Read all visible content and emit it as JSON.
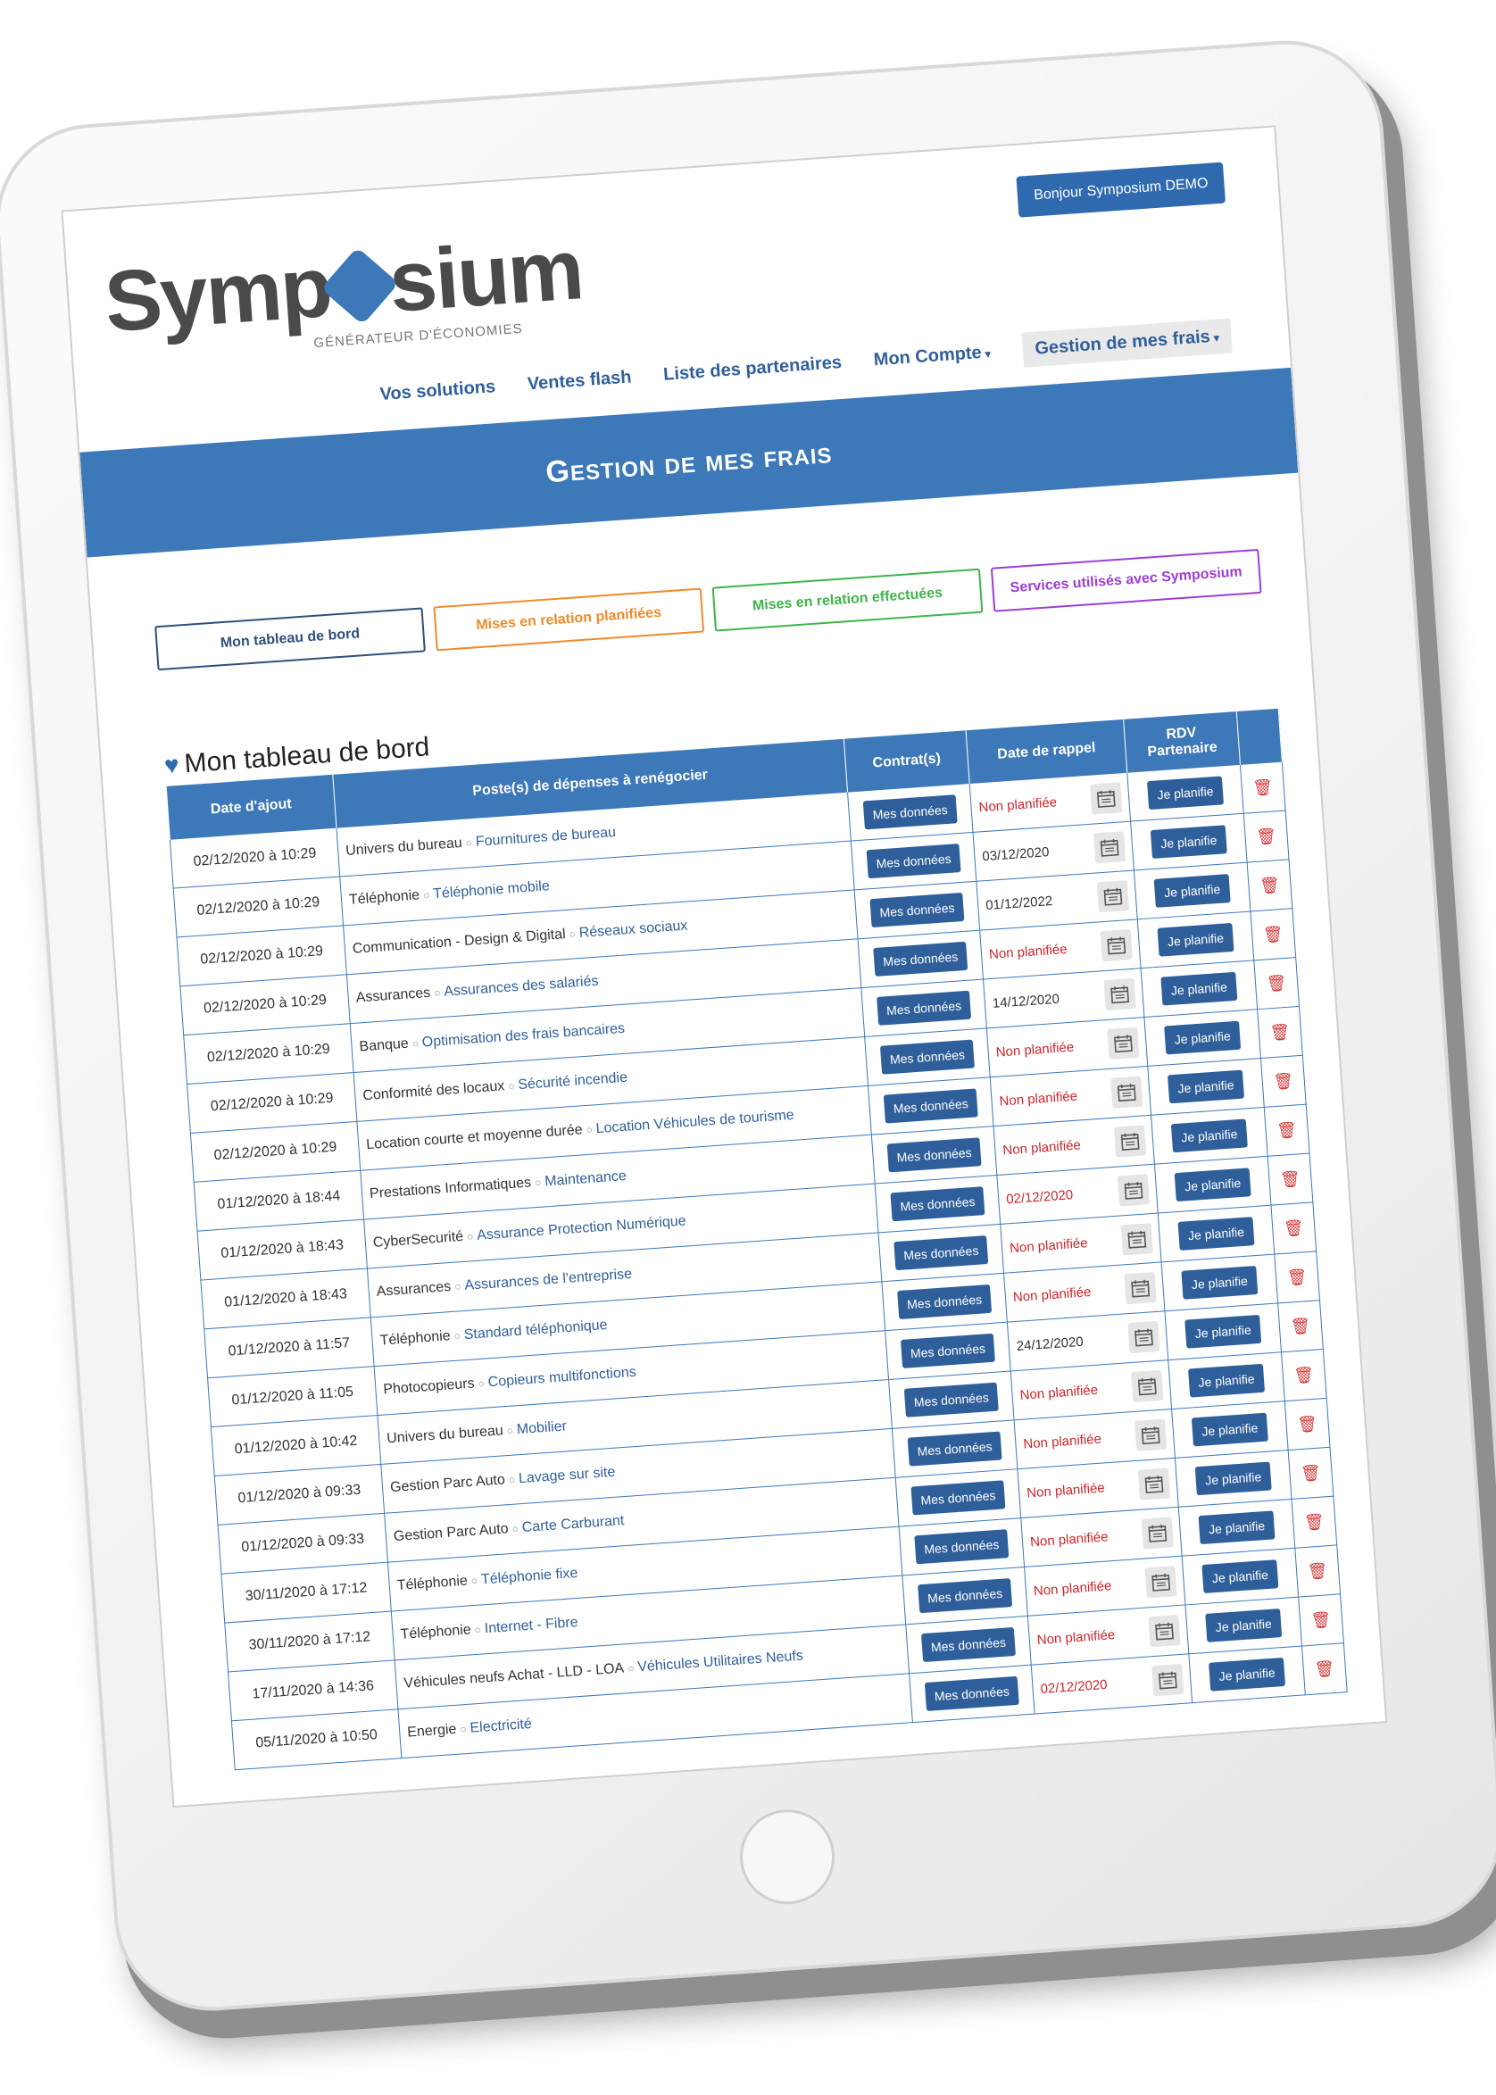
{
  "brand": {
    "name_part1": "Symp",
    "name_part2": "sium",
    "tagline": "GÉNÉRATEUR D'ÉCONOMIES"
  },
  "header": {
    "greeting": "Bonjour Symposium DEMO",
    "nav": [
      {
        "label": "Vos solutions"
      },
      {
        "label": "Ventes flash"
      },
      {
        "label": "Liste des partenaires"
      },
      {
        "label": "Mon Compte"
      },
      {
        "label": "Gestion de mes frais"
      }
    ]
  },
  "banner": {
    "title": "Gestion de mes frais"
  },
  "tabs": [
    {
      "label": "Mon tableau de bord"
    },
    {
      "label": "Mises en relation planifiées"
    },
    {
      "label": "Mises en relation effectuées"
    },
    {
      "label": "Services utilisés avec Symposium"
    }
  ],
  "section": {
    "title": "Mon tableau de bord"
  },
  "table": {
    "headers": {
      "date": "Date d'ajout",
      "poste": "Poste(s) de dépenses à renégocier",
      "contrat": "Contrat(s)",
      "rappel": "Date de rappel",
      "rdv": "RDV Partenaire"
    },
    "contract_button": "Mes données",
    "rdv_button": "Je planifie",
    "rows": [
      {
        "date": "02/12/2020 à 10:29",
        "cat": "Univers du bureau",
        "sub": "Fournitures de bureau",
        "rappel": "Non planifiée",
        "rappel_red": true
      },
      {
        "date": "02/12/2020 à 10:29",
        "cat": "Téléphonie",
        "sub": "Téléphonie mobile",
        "rappel": "03/12/2020",
        "rappel_red": false
      },
      {
        "date": "02/12/2020 à 10:29",
        "cat": "Communication - Design & Digital",
        "sub": "Réseaux sociaux",
        "rappel": "01/12/2022",
        "rappel_red": false
      },
      {
        "date": "02/12/2020 à 10:29",
        "cat": "Assurances",
        "sub": "Assurances des salariés",
        "rappel": "Non planifiée",
        "rappel_red": true
      },
      {
        "date": "02/12/2020 à 10:29",
        "cat": "Banque",
        "sub": "Optimisation des frais bancaires",
        "rappel": "14/12/2020",
        "rappel_red": false
      },
      {
        "date": "02/12/2020 à 10:29",
        "cat": "Conformité des locaux",
        "sub": "Sécurité incendie",
        "rappel": "Non planifiée",
        "rappel_red": true
      },
      {
        "date": "02/12/2020 à 10:29",
        "cat": "Location courte et moyenne durée",
        "sub": "Location Véhicules de tourisme",
        "rappel": "Non planifiée",
        "rappel_red": true
      },
      {
        "date": "01/12/2020 à 18:44",
        "cat": "Prestations Informatiques",
        "sub": "Maintenance",
        "rappel": "Non planifiée",
        "rappel_red": true
      },
      {
        "date": "01/12/2020 à 18:43",
        "cat": "CyberSecurité",
        "sub": "Assurance Protection Numérique",
        "rappel": "02/12/2020",
        "rappel_red": true
      },
      {
        "date": "01/12/2020 à 18:43",
        "cat": "Assurances",
        "sub": "Assurances de l'entreprise",
        "rappel": "Non planifiée",
        "rappel_red": true
      },
      {
        "date": "01/12/2020 à 11:57",
        "cat": "Téléphonie",
        "sub": "Standard téléphonique",
        "rappel": "Non planifiée",
        "rappel_red": true
      },
      {
        "date": "01/12/2020 à 11:05",
        "cat": "Photocopieurs",
        "sub": "Copieurs multifonctions",
        "rappel": "24/12/2020",
        "rappel_red": false
      },
      {
        "date": "01/12/2020 à 10:42",
        "cat": "Univers du bureau",
        "sub": "Mobilier",
        "rappel": "Non planifiée",
        "rappel_red": true
      },
      {
        "date": "01/12/2020 à 09:33",
        "cat": "Gestion Parc Auto",
        "sub": "Lavage sur site",
        "rappel": "Non planifiée",
        "rappel_red": true
      },
      {
        "date": "01/12/2020 à 09:33",
        "cat": "Gestion Parc Auto",
        "sub": "Carte Carburant",
        "rappel": "Non planifiée",
        "rappel_red": true
      },
      {
        "date": "30/11/2020 à 17:12",
        "cat": "Téléphonie",
        "sub": "Téléphonie fixe",
        "rappel": "Non planifiée",
        "rappel_red": true
      },
      {
        "date": "30/11/2020 à 17:12",
        "cat": "Téléphonie",
        "sub": "Internet - Fibre",
        "rappel": "Non planifiée",
        "rappel_red": true
      },
      {
        "date": "17/11/2020 à 14:36",
        "cat": "Véhicules neufs Achat - LLD - LOA",
        "sub": "Véhicules Utilitaires Neufs",
        "rappel": "Non planifiée",
        "rappel_red": true
      },
      {
        "date": "05/11/2020 à 10:50",
        "cat": "Energie",
        "sub": "Electricité",
        "rappel": "02/12/2020",
        "rappel_red": true
      }
    ]
  },
  "colors": {
    "primary": "#3d78b8",
    "button": "#2f5f9b",
    "red": "#d0252b",
    "orange": "#f08b2a",
    "green": "#3eb54a",
    "purple": "#9b3fd6"
  },
  "icons": [
    "heart-icon",
    "calendar-icon",
    "trash-icon",
    "chevron-down-icon"
  ]
}
